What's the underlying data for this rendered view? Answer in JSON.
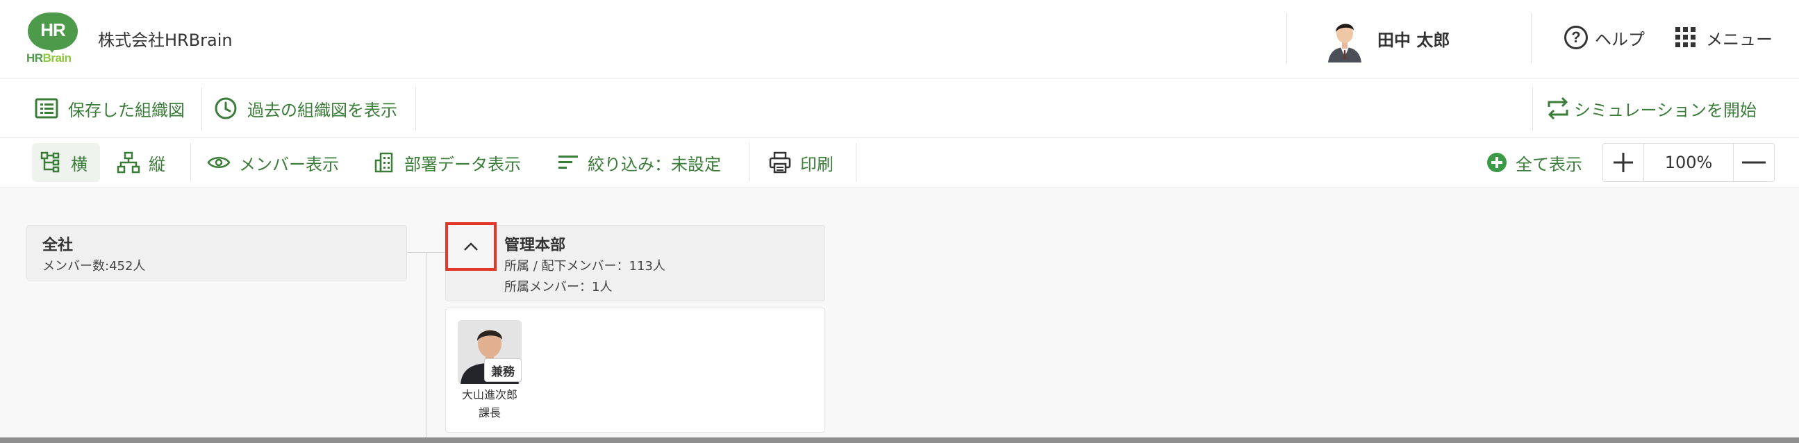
{
  "header": {
    "logo_mark": "HR",
    "logo_text_hr": "HR",
    "logo_text_brain": "Brain",
    "company_name": "株式会社HRBrain",
    "user_name": "田中 太郎",
    "help_label": "ヘルプ",
    "menu_label": "メニュー"
  },
  "toolbar_primary": {
    "saved_chart_label": "保存した組織図",
    "past_chart_label": "過去の組織図を表示",
    "simulation_label": "シミュレーションを開始"
  },
  "toolbar_secondary": {
    "horizontal_label": "横",
    "vertical_label": "縦",
    "member_display_label": "メンバー表示",
    "dept_data_label": "部署データ表示",
    "filter_label": "絞り込み：未設定",
    "print_label": "印刷",
    "show_all_label": "全て表示",
    "zoom_value": "100%",
    "active_layout": "横"
  },
  "org": {
    "root": {
      "name": "全社",
      "member_count": "メンバー数:452人"
    },
    "department": {
      "name": "管理本部",
      "subordinate_count": "所属 / 配下メンバー：113人",
      "direct_count": "所属メンバー：1人",
      "expanded": true
    },
    "members": [
      {
        "name": "大山進次郎",
        "title": "課長",
        "badge": "兼務"
      }
    ]
  },
  "colors": {
    "accent_green": "#3a7d38",
    "logo_green": "#4e9a4b",
    "highlight_red": "#e0392b"
  },
  "icons": [
    "help-icon",
    "grid-menu-icon",
    "list-icon",
    "clock-icon",
    "swap-icon",
    "tree-horizontal-icon",
    "tree-vertical-icon",
    "eye-icon",
    "building-icon",
    "filter-icon",
    "printer-icon",
    "plus-circle-icon",
    "plus-icon",
    "minus-icon",
    "chevron-up-icon"
  ]
}
